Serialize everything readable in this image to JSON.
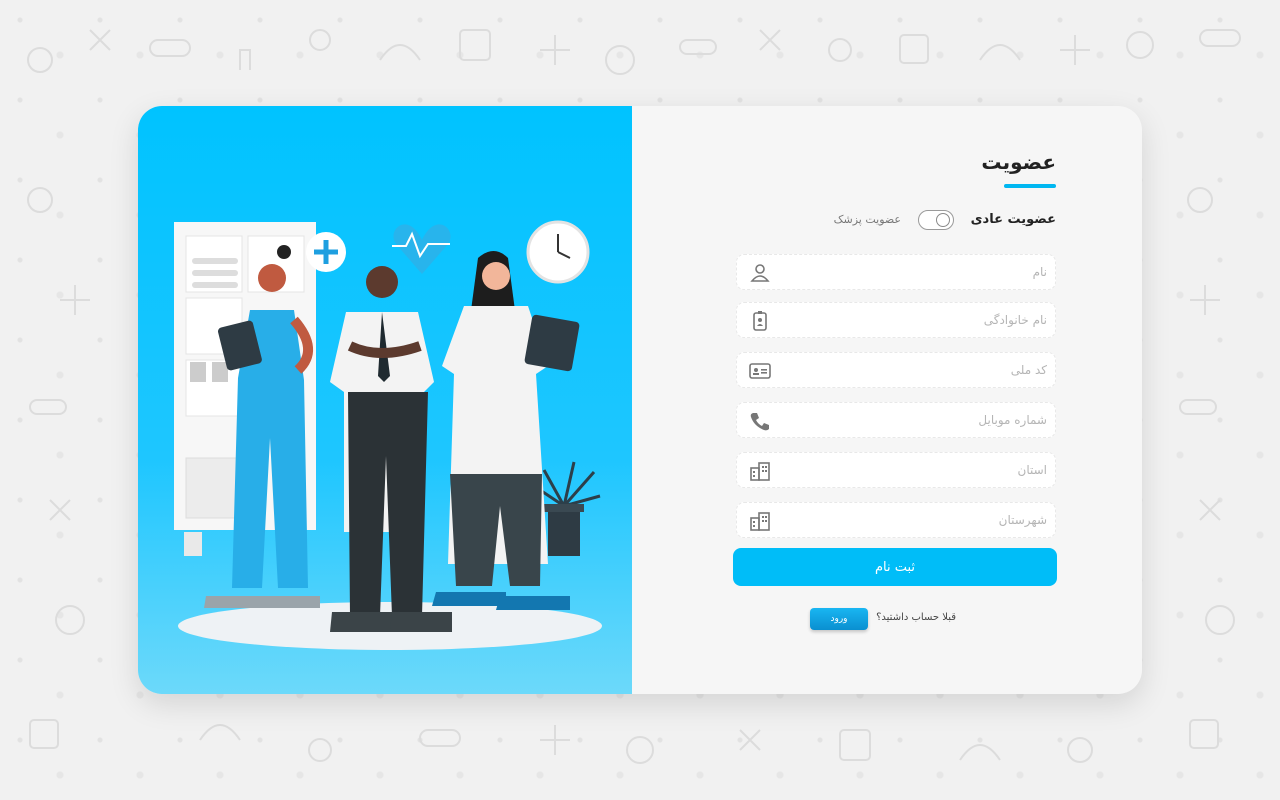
{
  "form": {
    "title": "عضویت",
    "membership_normal": "عضویت عادی",
    "membership_doctor": "عضویت پزشک",
    "fields": [
      {
        "placeholder": "نام",
        "icon": "user-icon"
      },
      {
        "placeholder": "نام خانوادگی",
        "icon": "id-badge-icon"
      },
      {
        "placeholder": "کد ملی",
        "icon": "id-card-icon"
      },
      {
        "placeholder": "شماره موبایل",
        "icon": "phone-icon"
      },
      {
        "placeholder": "استان",
        "icon": "building-icon"
      },
      {
        "placeholder": "شهرستان",
        "icon": "city-icon"
      }
    ],
    "submit_label": "ثبت نام",
    "have_account": "قبلا حساب داشتید؟",
    "login_label": "ورود"
  },
  "colors": {
    "accent": "#00bdf8",
    "illustration_bg": "#00c3ff",
    "card_bg": "#f6f6f6"
  }
}
